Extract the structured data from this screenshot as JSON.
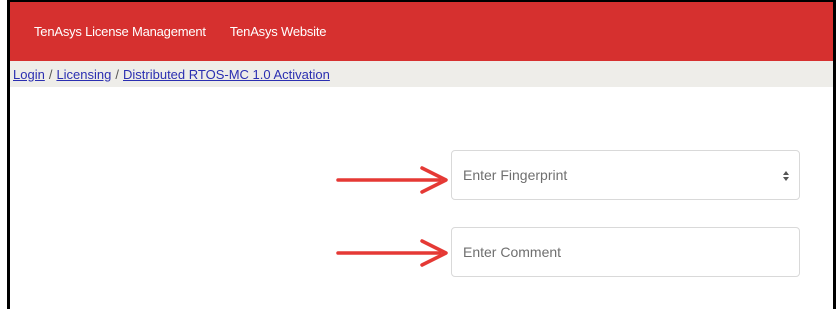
{
  "navbar": {
    "links": [
      {
        "label": "TenAsys License Management"
      },
      {
        "label": "TenAsys Website"
      }
    ],
    "background_color": "#d6302f"
  },
  "breadcrumb": {
    "items": [
      {
        "label": "Login"
      },
      {
        "label": "Licensing"
      },
      {
        "label": "Distributed RTOS-MC 1.0 Activation"
      }
    ],
    "separator": "/"
  },
  "form": {
    "fingerprint": {
      "placeholder": "Enter Fingerprint",
      "value": ""
    },
    "comment": {
      "placeholder": "Enter Comment",
      "value": ""
    }
  },
  "annotations": {
    "arrow_color": "#e53935",
    "arrow_icon": "right-arrow-icon"
  }
}
